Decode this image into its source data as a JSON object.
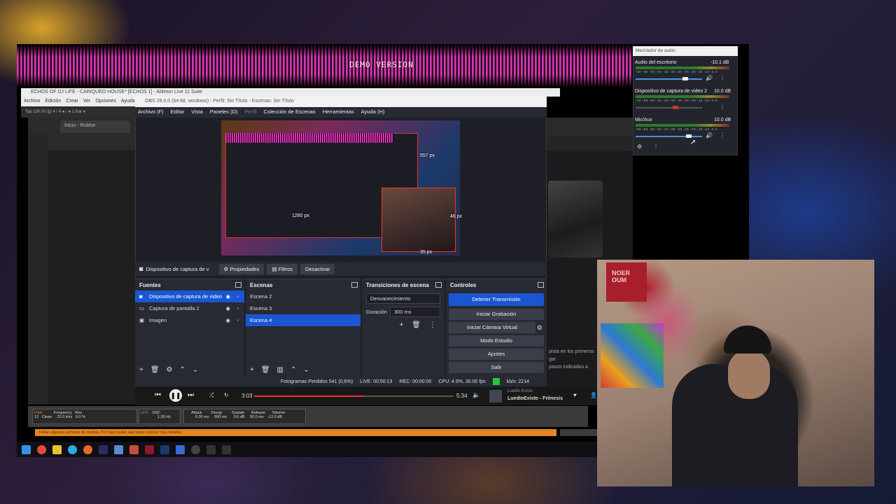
{
  "overlay": {
    "demo_text": "DEMO VERSION"
  },
  "ableton": {
    "title": "ECHOS OF DJ LIFE - CARIQUEO HOUSE* [ECHOS 1] - Ableton Live 11 Suite",
    "menu": [
      "Archivo",
      "Edición",
      "Crear",
      "Ver",
      "Opciones",
      "Ayuda"
    ],
    "toolbar": "Tap   130.00   ||||   4 / 4   ●○   ● 1 Bar ▾",
    "bottom": {
      "filter": "Filter",
      "frequency": "Frequency",
      "freq_val": "22.0 kHz",
      "res": "Res",
      "res_val": "0.0 %",
      "clean": "Clean",
      "num": "12",
      "lfo": "LFO",
      "osc": "OSC",
      "attack": "Attack",
      "attack_val": "0.00 ms",
      "decay": "Decay",
      "decay_val": "600 ms",
      "sustain": "Sustain",
      "sustain_val": "0.0 dB",
      "release": "Release",
      "release_val": "50.0 ms",
      "volume": "Volume",
      "volume_val": "-12.0 dB",
      "hz": "1.00 Hz"
    },
    "error_bar": "Faltan algunos archivos de medios. Por favor pulse aquí para conocer más detalles."
  },
  "browser": {
    "tab_label": "Inicio - Roblox",
    "side_text": "pista en los primeros\ngar\npasos indicados a"
  },
  "obs": {
    "title": "OBS 29.0.0 (64-bit, windows) - Perfil: Sin Título - Escenas: Sin Título",
    "menu": [
      "Archivo (F)",
      "Editar",
      "Vista",
      "Paneles (D)",
      "Perfil",
      "Colección de Escenas",
      "Herramientas",
      "Ayuda (H)"
    ],
    "preview_labels": {
      "w": "1280 px",
      "h": "557 px",
      "cam_h": "46 px",
      "cam_w": "35 px"
    },
    "source_bar": {
      "name": "Dispositivo de captura de v",
      "props": "Propiedades",
      "filters": "Filtros",
      "deactivate": "Desactivar"
    },
    "sources": {
      "title": "Fuentes",
      "items": [
        "Dispositivo de captura de video",
        "Captura de pantalla 2",
        "Imagen"
      ]
    },
    "scenes": {
      "title": "Escenas",
      "items": [
        "Escena 2",
        "Escena 3",
        "Escena 4"
      ]
    },
    "transitions": {
      "title": "Transiciones de escena",
      "type": "Desvanecimiento",
      "duration_label": "Duración",
      "duration_value": "300 ms"
    },
    "controls": {
      "title": "Controles",
      "buttons": [
        "Detener Transmisión",
        "Iniciar Grabación",
        "Iniciar Cámara Virtual",
        "Modo Estudio",
        "Ajustes",
        "Salir"
      ]
    },
    "status": {
      "dropped": "Fotogramas Perdidos 541 (0,6%)",
      "live": "LIVE: 00:50:13",
      "rec": "REC: 00:00:00",
      "cpu": "CPU: 4.9%, 30.00 fps",
      "kbs": "kb/s: 2214"
    }
  },
  "mixer": {
    "title": "Mezclador de audio",
    "scale": "-60 -55 -50 -45 -40 -35 -30 -25 -20 -15 -10 -5 0",
    "channels": [
      {
        "name": "Audio del escritorio",
        "value": "-10.1 dB",
        "level": 0.75
      },
      {
        "name": "Dispositivo de captura de video 2",
        "value": "10.0 dB",
        "level": 0.6
      },
      {
        "name": "Mic/Aux",
        "value": "10.0 dB",
        "level": 0.8
      }
    ]
  },
  "player": {
    "elapsed": "3:03",
    "total": "5:34",
    "artist": "Luedio Existo",
    "track": "LuedioExisto - Frénesis",
    "progress": 0.55
  },
  "webcam": {
    "poster_text": "NOER\nOUM"
  }
}
